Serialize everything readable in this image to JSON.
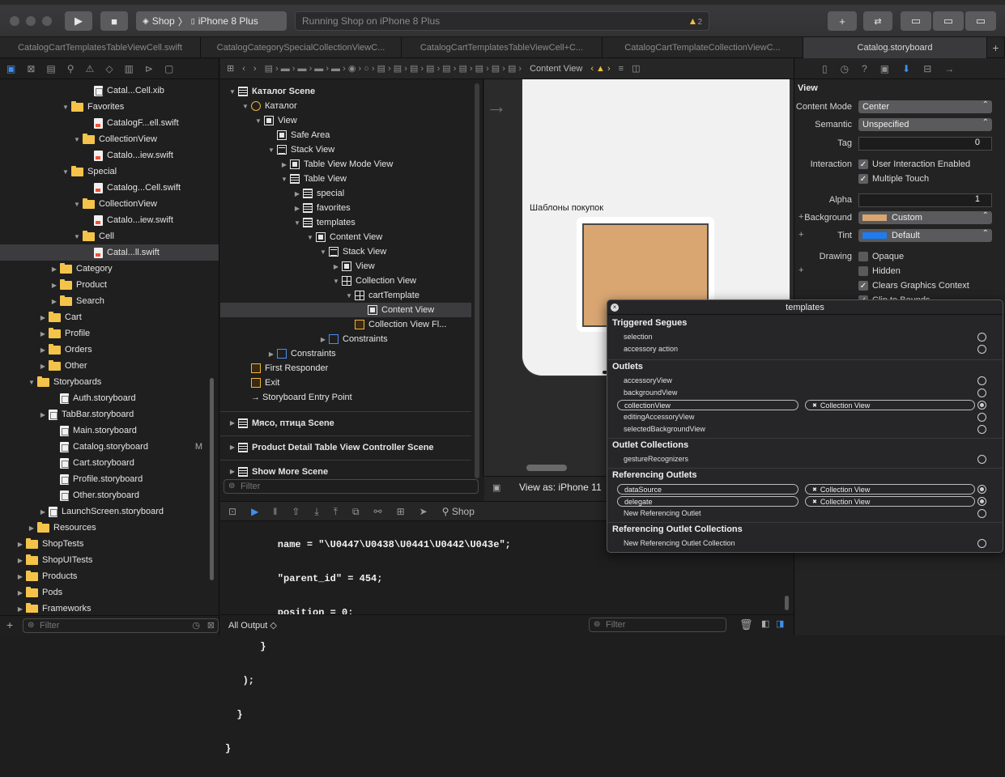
{
  "toolbar": {
    "scheme": "Shop",
    "device": "iPhone 8 Plus",
    "status": "Running Shop on iPhone 8 Plus",
    "warnings": "2"
  },
  "tabs": [
    "CatalogCartTemplatesTableViewCell.swift",
    "CatalogCategorySpecialCollectionViewC...",
    "CatalogCartTemplatesTableViewCell+C...",
    "CatalogCartTemplateCollectionViewC...",
    "Catalog.storyboard"
  ],
  "navigator": {
    "rows": [
      {
        "label": "Catal...Cell.xib",
        "kind": "xib",
        "depth": 6
      },
      {
        "label": "Favorites",
        "kind": "folder",
        "depth": 4,
        "open": true
      },
      {
        "label": "CatalogF...ell.swift",
        "kind": "swift",
        "depth": 6
      },
      {
        "label": "CollectionView",
        "kind": "folder",
        "depth": 5,
        "open": true
      },
      {
        "label": "Catalo...iew.swift",
        "kind": "swift",
        "depth": 6
      },
      {
        "label": "Special",
        "kind": "folder",
        "depth": 4,
        "open": true
      },
      {
        "label": "Catalog...Cell.swift",
        "kind": "swift",
        "depth": 6
      },
      {
        "label": "CollectionView",
        "kind": "folder",
        "depth": 5,
        "open": true
      },
      {
        "label": "Catalo...iew.swift",
        "kind": "swift",
        "depth": 6
      },
      {
        "label": "Cell",
        "kind": "folder",
        "depth": 5,
        "open": true
      },
      {
        "label": "Catal...ll.swift",
        "kind": "swift",
        "depth": 6,
        "selected": true
      },
      {
        "label": "Category",
        "kind": "folder",
        "depth": 3
      },
      {
        "label": "Product",
        "kind": "folder",
        "depth": 3
      },
      {
        "label": "Search",
        "kind": "folder",
        "depth": 3
      },
      {
        "label": "Cart",
        "kind": "folder",
        "depth": 2
      },
      {
        "label": "Profile",
        "kind": "folder",
        "depth": 2
      },
      {
        "label": "Orders",
        "kind": "folder",
        "depth": 2
      },
      {
        "label": "Other",
        "kind": "folder",
        "depth": 2
      },
      {
        "label": "Storyboards",
        "kind": "folder",
        "depth": 1,
        "open": true
      },
      {
        "label": "Auth.storyboard",
        "kind": "sb",
        "depth": 3
      },
      {
        "label": "TabBar.storyboard",
        "kind": "sb",
        "depth": 2
      },
      {
        "label": "Main.storyboard",
        "kind": "sb",
        "depth": 3
      },
      {
        "label": "Catalog.storyboard",
        "kind": "sb",
        "depth": 3,
        "flag": "M"
      },
      {
        "label": "Cart.storyboard",
        "kind": "sb",
        "depth": 3
      },
      {
        "label": "Profile.storyboard",
        "kind": "sb",
        "depth": 3
      },
      {
        "label": "Other.storyboard",
        "kind": "sb",
        "depth": 3
      },
      {
        "label": "LaunchScreen.storyboard",
        "kind": "sb",
        "depth": 2
      },
      {
        "label": "Resources",
        "kind": "folder",
        "depth": 1
      },
      {
        "label": "ShopTests",
        "kind": "folder",
        "depth": 0
      },
      {
        "label": "ShopUITests",
        "kind": "folder",
        "depth": 0
      },
      {
        "label": "Products",
        "kind": "folder",
        "depth": 0
      },
      {
        "label": "Pods",
        "kind": "folder",
        "depth": 0
      },
      {
        "label": "Frameworks",
        "kind": "folder",
        "depth": 0
      }
    ],
    "filter": "Filter"
  },
  "jumpbar": {
    "last": "Content View"
  },
  "outline": {
    "rows": [
      {
        "label": "Каталог Scene",
        "icon": "tbl",
        "depth": 0,
        "bold": true,
        "disc": "▼"
      },
      {
        "label": "Каталог",
        "icon": "yel",
        "depth": 1,
        "disc": "▼"
      },
      {
        "label": "View",
        "icon": "view",
        "depth": 2,
        "disc": "▼"
      },
      {
        "label": "Safe Area",
        "icon": "view",
        "depth": 3,
        "disc": ""
      },
      {
        "label": "Stack View",
        "icon": "stack",
        "depth": 3,
        "disc": "▼"
      },
      {
        "label": "Table View Mode View",
        "icon": "view",
        "depth": 4,
        "disc": "▶"
      },
      {
        "label": "Table View",
        "icon": "tbl",
        "depth": 4,
        "disc": "▼"
      },
      {
        "label": "special",
        "icon": "tbl",
        "depth": 5,
        "disc": "▶"
      },
      {
        "label": "favorites",
        "icon": "tbl",
        "depth": 5,
        "disc": "▶"
      },
      {
        "label": "templates",
        "icon": "tbl",
        "depth": 5,
        "disc": "▼"
      },
      {
        "label": "Content View",
        "icon": "view",
        "depth": 6,
        "disc": "▼"
      },
      {
        "label": "Stack View",
        "icon": "stack",
        "depth": 7,
        "disc": "▼"
      },
      {
        "label": "View",
        "icon": "view",
        "depth": 8,
        "disc": "▶"
      },
      {
        "label": "Collection View",
        "icon": "grid",
        "depth": 8,
        "disc": "▼"
      },
      {
        "label": "cartTemplate",
        "icon": "grid",
        "depth": 9,
        "disc": "▼"
      },
      {
        "label": "Content View",
        "icon": "view",
        "depth": 10,
        "disc": "",
        "selected": true
      },
      {
        "label": "Collection View Fl...",
        "icon": "yelsq",
        "depth": 9,
        "disc": ""
      },
      {
        "label": "Constraints",
        "icon": "blue",
        "depth": 7,
        "disc": "▶"
      },
      {
        "label": "Constraints",
        "icon": "blue",
        "depth": 3,
        "disc": "▶"
      },
      {
        "label": "First Responder",
        "icon": "yelsq",
        "depth": 1,
        "disc": ""
      },
      {
        "label": "Exit",
        "icon": "yelsq",
        "depth": 1,
        "disc": ""
      },
      {
        "label": "→ Storyboard Entry Point",
        "icon": "",
        "depth": 1,
        "disc": ""
      }
    ],
    "scenes": [
      "Мясо, птица Scene",
      "Product Detail Table View Controller Scene",
      "Show More Scene"
    ],
    "filter": "Filter"
  },
  "canvas": {
    "cell_title": "Шаблоны покупок",
    "view_as": "View as: iPhone 11"
  },
  "debug": {
    "process": "Shop"
  },
  "console": {
    "lines": [
      "         name = \"\\U0447\\U0438\\U0441\\U0442\\U043e\";",
      "         \"parent_id\" = 454;",
      "         position = 0;",
      "      }",
      "   );",
      "  }",
      "}"
    ]
  },
  "bottom": {
    "output": "All Output ◇",
    "filter": "Filter"
  },
  "inspector": {
    "section": "View",
    "content_mode": "Center",
    "semantic": "Unspecified",
    "tag": "0",
    "interaction": [
      "User Interaction Enabled",
      "Multiple Touch"
    ],
    "alpha": "1",
    "background": "Custom",
    "tint": "Default",
    "drawing": [
      "Opaque",
      "Hidden",
      "Clears Graphics Context",
      "Clip to Bounds"
    ],
    "labels": {
      "content_mode": "Content Mode",
      "semantic": "Semantic",
      "tag": "Tag",
      "interaction": "Interaction",
      "alpha": "Alpha",
      "background": "Background",
      "tint": "Tint",
      "drawing": "Drawing"
    },
    "colors": {
      "background": "#d9a672",
      "tint": "#1e7cf2"
    }
  },
  "connections": {
    "title": "templates",
    "sections": {
      "segues": "Triggered Segues",
      "outlets": "Outlets",
      "collections": "Outlet Collections",
      "referencing": "Referencing Outlets",
      "ref_collections": "Referencing Outlet Collections"
    },
    "segues": [
      "selection",
      "accessory action"
    ],
    "outlets": [
      "accessoryView",
      "backgroundView",
      "collectionView",
      "editingAccessoryView",
      "selectedBackgroundView"
    ],
    "outlet_target": "Collection View",
    "collections": [
      "gestureRecognizers"
    ],
    "referencing": [
      "dataSource",
      "delegate",
      "New Referencing Outlet"
    ],
    "ref_target": "Collection View",
    "ref_collections": [
      "New Referencing Outlet Collection"
    ]
  }
}
